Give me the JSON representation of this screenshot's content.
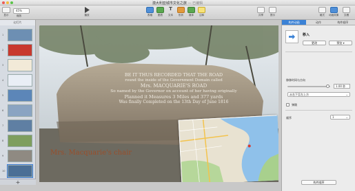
{
  "window": {
    "title": "澳大利亚城市文化之旅",
    "status": "— 已编辑"
  },
  "toolbar": {
    "zoom_value": "45%",
    "view_label": "显示",
    "zoom_label": "缩放",
    "play_label": "播放",
    "table_label": "表格",
    "chart_label": "图表",
    "text_label": "文本",
    "shape_label": "形状",
    "media_label": "媒体",
    "comment_label": "注释",
    "share_label": "共享",
    "tips_label": "提示",
    "format_label": "格式",
    "animate_label": "动画效果",
    "document_label": "文稿"
  },
  "navigator": {
    "header": "幻灯片",
    "slides": [
      {
        "num": "1",
        "bg": "#6d8fb3"
      },
      {
        "num": "2",
        "bg": "#c8392e"
      },
      {
        "num": "3",
        "bg": "#f2ead8"
      },
      {
        "num": "4",
        "bg": "#e9eef5"
      },
      {
        "num": "5",
        "bg": "#5c86b8"
      },
      {
        "num": "6",
        "bg": "#8aa4c2"
      },
      {
        "num": "7",
        "bg": "#5f7fa3"
      },
      {
        "num": "8",
        "bg": "#7e9e5e"
      },
      {
        "num": "9",
        "bg": "#8f8a82"
      },
      {
        "num": "10",
        "bg": "#4b6f96"
      }
    ],
    "add_label": "+"
  },
  "slide": {
    "caption": "Mrs. Macquarie's chair",
    "caption_color": "#9a4e2a",
    "inscription": [
      "BE IT THUS RECORDED THAT THE ROAD",
      "round the inside of the Government Domain called",
      "Mrs. MACQUARIE'S ROAD",
      "So named by the Governor on account of her having originally",
      "Planned it Measures 3 Miles and 377 yards",
      "Was finally Completed on the 13th Day of June 1816"
    ]
  },
  "inspector": {
    "tabs": [
      "构件动画",
      "动作",
      "构件顺序"
    ],
    "active_tab": 0,
    "effect_name": "移入",
    "change_button": "更改",
    "preview_button": "预览",
    "duration_label": "移移时间与方向",
    "duration_value": "1.00 秒",
    "duration_fraction": 0.98,
    "direction_value": "从右下至左上方",
    "bounce_label": "弹跳",
    "delivery_label": "顺序",
    "delivery_value": "1",
    "build_order_button": "构件顺序"
  }
}
